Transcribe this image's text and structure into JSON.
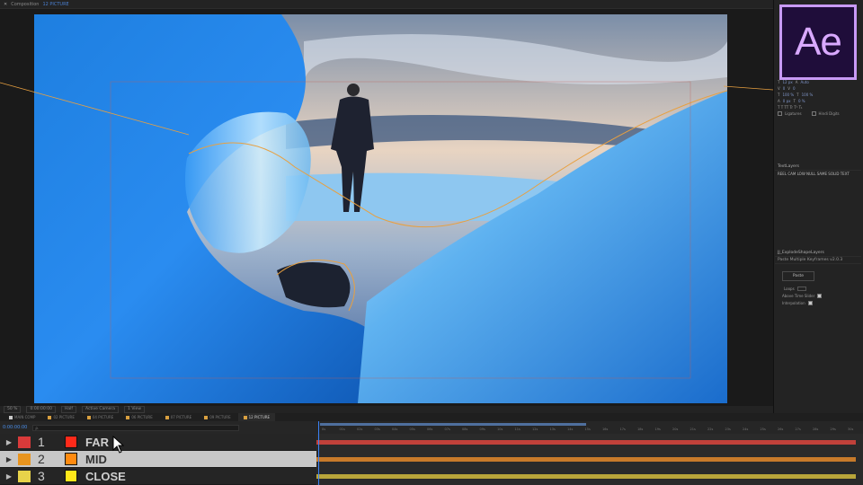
{
  "app": {
    "logo_text": "Ae",
    "logo_color": "#d9a9ff"
  },
  "composition_panel": {
    "header_label": "Composition",
    "active_comp": "12 PICTURE",
    "footer": {
      "zoom": "50 %",
      "timecode": "0:00:00:00",
      "resolution": "Half",
      "camera": "Active Camera",
      "views": "1 View"
    }
  },
  "right_panel": {
    "character_rows": [
      "12 px",
      "Auto",
      "0",
      "0",
      "100 %",
      "100 %",
      "0 px",
      "0 %"
    ],
    "ligatures_label": "Ligatures",
    "hindi_digits_label": "Hindi Digits",
    "textlayers_title": "TextLayers",
    "textlayers_content": "REEL CAM LOW NULL SAME SOLID TEXT",
    "explode_title": "JJ_ExplodeShapeLayers",
    "paste_panel_title": "Paste Multiple Keyframes v2.0.3",
    "paste_button": "Paste",
    "loops_label": "Loops",
    "above_slider_label": "Above Time Slider",
    "interpolation_label": "Interpolation"
  },
  "timeline": {
    "tabs": [
      {
        "label": "MAIN COMP",
        "active": false,
        "color": "#c9c9c9"
      },
      {
        "label": "02 PICTURE",
        "active": false,
        "color": "#d9a040"
      },
      {
        "label": "04 PICTURE",
        "active": false,
        "color": "#d9a040"
      },
      {
        "label": "06 PICTURE",
        "active": false,
        "color": "#d9a040"
      },
      {
        "label": "07 PICTURE",
        "active": false,
        "color": "#d9a040"
      },
      {
        "label": "09 PICTURE",
        "active": false,
        "color": "#d9a040"
      },
      {
        "label": "12 PICTURE",
        "active": true,
        "color": "#d9a040"
      }
    ],
    "timecode": "0:00:00:00",
    "search_placeholder": "ρ.",
    "ruler_labels": [
      "0s",
      "01s",
      "02s",
      "03s",
      "04s",
      "05s",
      "06s",
      "07s",
      "08s",
      "09s",
      "10s",
      "11s",
      "12s",
      "13s",
      "14s",
      "15s",
      "16s",
      "17s",
      "18s",
      "19s",
      "20s",
      "21s",
      "22s",
      "23s",
      "24s",
      "25s",
      "26s",
      "27s",
      "28s",
      "29s",
      "30s"
    ],
    "layers": [
      {
        "number": "1",
        "name": "FAR",
        "label_color": "#d93a3a",
        "type_color": "#ff2a1a",
        "track_color": "#c0413a",
        "selected": false
      },
      {
        "number": "2",
        "name": "MID",
        "label_color": "#e8941f",
        "type_color": "#ff8a10",
        "track_color": "#c77a2a",
        "selected": true
      },
      {
        "number": "3",
        "name": "CLOSE",
        "label_color": "#e8d34a",
        "type_color": "#ffe81a",
        "track_color": "#b9a53a",
        "selected": false
      }
    ]
  }
}
